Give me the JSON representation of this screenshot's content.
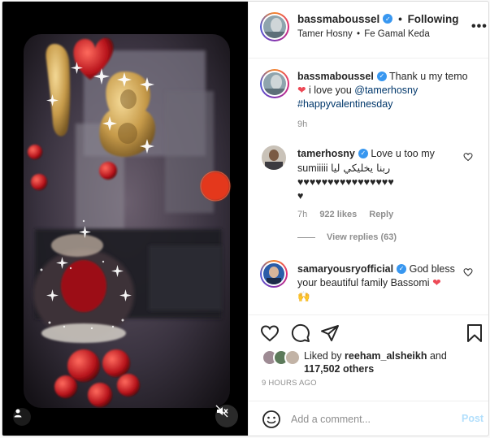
{
  "post": {
    "username": "bassmaboussel",
    "follow_separator": "•",
    "follow_status": "Following",
    "tagged_user": "Tamer Hosny",
    "location_separator": "•",
    "location": "Fe Gamal Keda",
    "more_icon": "more-horizontal-icon"
  },
  "comments": [
    {
      "username": "bassmaboussel",
      "text_1": "Thank u my temo",
      "text_2": "i love you",
      "mention": "@tamerhosny",
      "hashtag": "#happyvalentinesday",
      "time": "9h"
    },
    {
      "username": "tamerhosny",
      "text_1": "Love u too my",
      "text_2": "sumiiiii",
      "text_arabic": "ربنا يخليكي ليا",
      "hearts": "♥♥♥♥♥♥♥♥♥♥♥♥♥♥♥♥",
      "hearts_end": "♥",
      "time": "7h",
      "likes": "922 likes",
      "reply": "Reply",
      "view_replies": "View replies (63)"
    },
    {
      "username": "samaryousryofficial",
      "text_1": "God bless",
      "text_2": "your beautiful family Bassomi",
      "emoji_hands": "🙌"
    }
  ],
  "actions": {
    "liked_by_prefix": "Liked by",
    "liked_by_user": "reeham_alsheikh",
    "liked_by_and": "and",
    "liked_by_count": "117,502 others",
    "time_ago": "9 HOURS AGO"
  },
  "add_comment": {
    "placeholder": "Add a comment...",
    "post_label": "Post"
  },
  "colors": {
    "verified": "#3897f0",
    "heart": "#ed4956",
    "link": "#00376b",
    "post_disabled": "#b2dffc"
  }
}
